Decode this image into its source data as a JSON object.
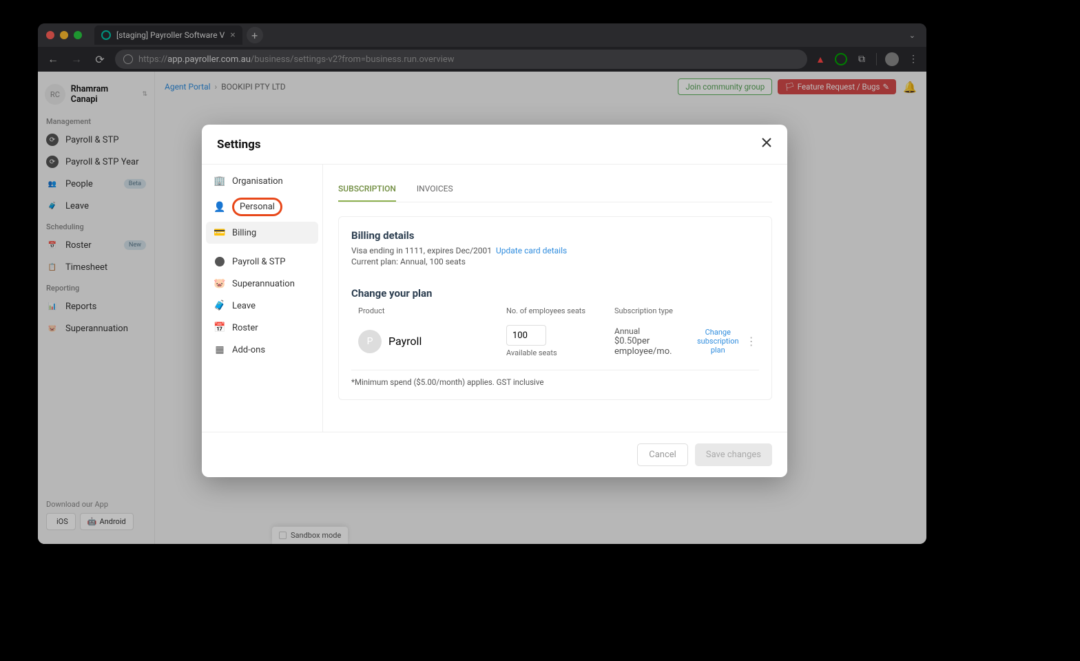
{
  "browser": {
    "tab_title": "[staging] Payroller Software V",
    "url_prefix": "https://",
    "url_domain": "app.payroller.com.au",
    "url_path": "/business/settings-v2?from=business.run.overview"
  },
  "sidebar": {
    "user_initials": "RC",
    "user_name": "Rhamram Canapi",
    "sections": {
      "management": "Management",
      "scheduling": "Scheduling",
      "reporting": "Reporting"
    },
    "items": {
      "payroll_stp": "Payroll & STP",
      "payroll_stp_year": "Payroll & STP Year",
      "people": "People",
      "people_badge": "Beta",
      "leave": "Leave",
      "roster": "Roster",
      "roster_badge": "New",
      "timesheet": "Timesheet",
      "reports": "Reports",
      "superannuation": "Superannuation"
    },
    "download_label": "Download our App",
    "ios": "iOS",
    "android": "Android",
    "sandbox": "Sandbox mode"
  },
  "topbar": {
    "agent_portal": "Agent Portal",
    "company": "BOOKIPI PTY LTD",
    "community": "Join community group",
    "feature": "Feature Request / Bugs"
  },
  "modal": {
    "title": "Settings",
    "nav": {
      "organisation": "Organisation",
      "personal": "Personal",
      "billing": "Billing",
      "payroll_stp": "Payroll & STP",
      "superannuation": "Superannuation",
      "leave": "Leave",
      "roster": "Roster",
      "addons": "Add-ons"
    },
    "tabs": {
      "subscription": "SUBSCRIPTION",
      "invoices": "INVOICES"
    },
    "billing": {
      "heading": "Billing details",
      "card_info": "Visa ending in 1111, expires Dec/2001",
      "update_link": "Update card details",
      "plan_info": "Current plan: Annual, 100 seats"
    },
    "change_plan": {
      "heading": "Change your plan",
      "cols": {
        "product": "Product",
        "seats": "No. of employees seats",
        "sub_type": "Subscription type"
      },
      "row": {
        "product_letter": "P",
        "product": "Payroll",
        "seats": "100",
        "seats_available": "Available seats",
        "type": "Annual",
        "price": "$0.50per employee/mo.",
        "change1": "Change",
        "change2": "subscription",
        "change3": "plan"
      },
      "footnote": "*Minimum spend ($5.00/month) applies. GST inclusive"
    },
    "footer": {
      "cancel": "Cancel",
      "save": "Save changes"
    }
  }
}
